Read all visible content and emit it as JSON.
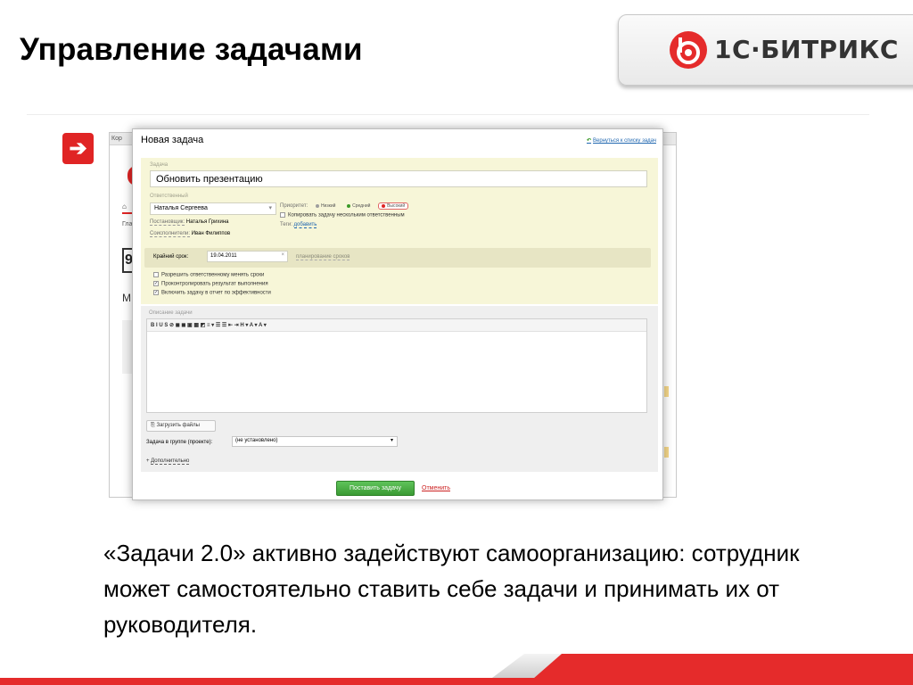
{
  "slide": {
    "title": "Управление задачами",
    "body": "«Задачи 2.0» активно задействуют самоорганизацию: сотрудник может самостоятельно ставить себе задачи и принимать их от руководителя."
  },
  "logo": {
    "text": "1С·БИТРИКС",
    "brand_color": "#e52b2b"
  },
  "arrow_icon": "right-arrow-icon",
  "background_window": {
    "tab_text": "Кор",
    "nav_text": "Гла",
    "section_letter": "М",
    "box_letter": "9"
  },
  "dialog": {
    "title": "Новая задача",
    "back_link": "Вернуться к списку задач",
    "task_label": "Задача",
    "task_value": "Обновить презентацию",
    "responsible_label": "Ответственный",
    "responsible_value": "Наталья Сергеева",
    "creator_label": "Постановщик:",
    "creator_value": "Наталья Грихина",
    "accomplices_label": "Соисполнители:",
    "accomplices_value": "Иван Филиппов",
    "priority_label": "Приоритет:",
    "priorities": [
      "Низкий",
      "Средний",
      "Высокий"
    ],
    "priority_colors": [
      "#9e9e9e",
      "#3a9a27",
      "#e02424"
    ],
    "copy_option": "Копировать задачу нескольким ответственным",
    "tags_label": "Теги:",
    "tags_link": "добавить",
    "deadline_label": "Крайний срок:",
    "deadline_value": "19.04.2011",
    "deadline_plan_link": "планирование сроков",
    "options": [
      {
        "label": "Разрешить ответственному менять сроки",
        "checked": false
      },
      {
        "label": "Проконтролировать результат выполнения",
        "checked": true
      },
      {
        "label": "Включить задачу в отчет по эффективности",
        "checked": true
      }
    ],
    "description_label": "Описание задачи",
    "editor_toolbar": "B  I  U  S  ⊘  ◼  ◼  ▣  ▦  ◩  ≡ ▾  ☰  ☰  ⇤  ⇥  H ▾  A ▾  A ▾",
    "upload_button": "Загрузить файлы",
    "group_label": "Задача в группе (проекте):",
    "group_value": "(не установлено)",
    "more_link": "Дополнительно",
    "submit_button": "Поставить задачу",
    "cancel_link": "Отменить"
  }
}
